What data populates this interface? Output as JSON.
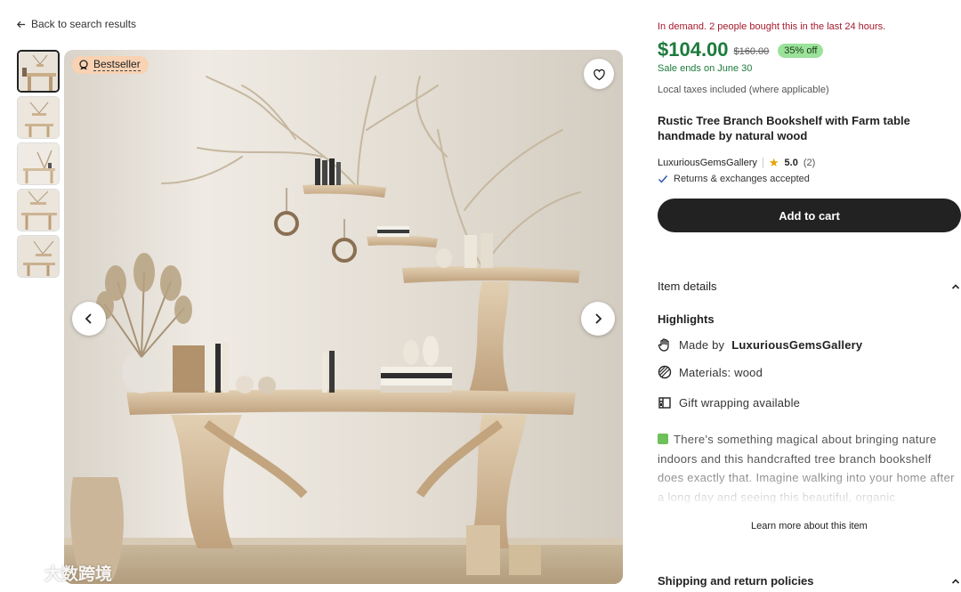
{
  "nav": {
    "back_label": "Back to search results"
  },
  "gallery": {
    "badge_label": "Bestseller",
    "thumbnail_count": 5
  },
  "listing": {
    "demand_text": "In demand. 2 people bought this in the last 24 hours.",
    "price": "$104.00",
    "original_price": "$160.00",
    "discount": "35% off",
    "sale_ends": "Sale ends on June 30",
    "taxes_note": "Local taxes included (where applicable)",
    "title": "Rustic Tree Branch Bookshelf with Farm table handmade by natural wood",
    "shop_name": "LuxuriousGemsGallery",
    "rating": "5.0",
    "review_count": "(2)",
    "returns": "Returns & exchanges accepted",
    "add_to_cart": "Add to cart"
  },
  "details": {
    "section_label": "Item details",
    "highlights_label": "Highlights",
    "made_by_prefix": "Made by",
    "made_by_shop": "LuxuriousGemsGallery",
    "materials": "Materials: wood",
    "gift_wrapping": "Gift wrapping available",
    "description": "There's something magical about bringing nature indoors and this handcrafted tree branch bookshelf does exactly that. Imagine walking into your home after a long day and seeing this beautiful, organic",
    "learn_more": "Learn more about this item"
  },
  "shipping": {
    "section_label": "Shipping and return policies"
  },
  "watermark": "大数跨境",
  "colors": {
    "price_green": "#1d7b3b",
    "demand_red": "#a61a2e",
    "discount_badge": "#9be29a",
    "bestseller_badge": "#f8d2b3",
    "cart_button": "#222222"
  }
}
